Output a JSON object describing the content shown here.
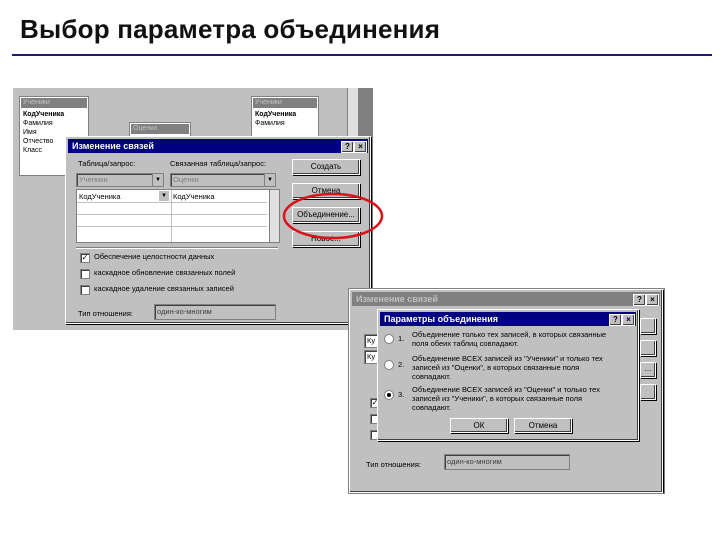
{
  "slide": {
    "title": "Выбор параметра объединения"
  },
  "screen1": {
    "table_uchenik": {
      "title": "Ученики",
      "fields": [
        "КодУченика",
        "Фамилия",
        "Имя",
        "Отчество",
        "Класс"
      ]
    },
    "table_ocenki": {
      "title": "Оценки"
    },
    "table_uchenik2": {
      "title": "Ученики",
      "fields": [
        "КодУченика",
        "Фамилия"
      ]
    },
    "dialog": {
      "title": "Изменение связей",
      "help": "?",
      "close": "×",
      "col_table_label": "Таблица/запрос:",
      "col_related_label": "Связанная таблица/запрос:",
      "table_value": "Ученики",
      "related_value": "Оценки",
      "field_left": "КодУченика",
      "field_right": "КодУченика",
      "buttons": {
        "create": "Создать",
        "cancel": "Отмена",
        "join": "Объединение...",
        "new": "Новое..."
      },
      "chk_integrity": "Обеспечение целостности данных",
      "chk_cascade_update": "каскадное обновление связанных полей",
      "chk_cascade_delete": "каскадное удаление связанных записей",
      "relation_type_label": "Тип отношения:",
      "relation_type_value": "один-ко-многим"
    }
  },
  "screen2": {
    "dialog": {
      "title": "Изменение связей",
      "help": "?",
      "close": "×",
      "field_left_short": "Ку",
      "field_left_short2": "Ку",
      "btn_dots": "...",
      "relation_type_label": "Тип отношения:",
      "relation_type_value": "один-ко-многим"
    },
    "join_dialog": {
      "title": "Параметры объединения",
      "help": "?",
      "close": "×",
      "options": [
        {
          "num": "1.",
          "text1": "Объединение только тех записей, в которых связанные",
          "text2": "поля обеих таблиц совпадают.",
          "selected": false
        },
        {
          "num": "2.",
          "text1": "Объединение ВСЕХ записей из \"Ученики\" и только тех",
          "text2": "записей из \"Оценки\", в которых связанные поля",
          "text3": "совпадают.",
          "selected": false
        },
        {
          "num": "3.",
          "text1": "Объединение ВСЕХ записей из \"Оценки\" и только тех",
          "text2": "записей из \"Ученики\", в которых связанные поля",
          "text3": "совпадают.",
          "selected": true
        }
      ],
      "ok": "ОК",
      "cancel": "Отмена"
    }
  },
  "colors": {
    "title_rule": "#1a1a80",
    "active_title": "#000080",
    "highlight_ellipse": "#d8141a"
  }
}
